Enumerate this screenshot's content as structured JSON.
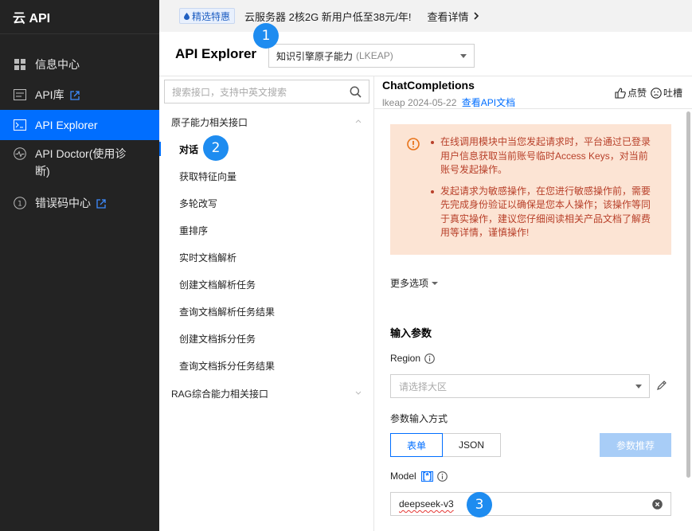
{
  "sidebar": {
    "brand": "云 API",
    "items": [
      {
        "label": "信息中心",
        "icon": "grid-icon",
        "external": false,
        "active": false
      },
      {
        "label": "API库",
        "icon": "library-icon",
        "external": true,
        "active": false
      },
      {
        "label": "API Explorer",
        "icon": "terminal-icon",
        "external": false,
        "active": true
      },
      {
        "label": "API Doctor(使用诊断)",
        "icon": "pulse-icon",
        "external": false,
        "active": false
      },
      {
        "label": "错误码中心",
        "icon": "error-code-icon",
        "external": true,
        "active": false
      }
    ]
  },
  "banner": {
    "badge": "精选特惠",
    "text": "云服务器 2核2G 新用户低至38元/年!",
    "link": "查看详情"
  },
  "header": {
    "title": "API Explorer",
    "product_select": "知识引擎原子能力",
    "product_select_sub": "(LKEAP)"
  },
  "api_list": {
    "search_placeholder": "搜索接口，支持中英文搜索",
    "groups": [
      {
        "label": "原子能力相关接口",
        "expanded": true,
        "items": [
          "对话",
          "获取特征向量",
          "多轮改写",
          "重排序",
          "实时文档解析",
          "创建文档解析任务",
          "查询文档解析任务结果",
          "创建文档拆分任务",
          "查询文档拆分任务结果"
        ],
        "selected": 0
      },
      {
        "label": "RAG综合能力相关接口",
        "expanded": false,
        "items": []
      }
    ]
  },
  "detail": {
    "api_name": "ChatCompletions",
    "meta_prefix": "lkeap 2024-05-22",
    "doc_link": "查看API文档",
    "like": "点赞",
    "complain": "吐槽",
    "warnings": [
      "在线调用模块中当您发起请求时，平台通过已登录用户信息获取当前账号临时Access Keys，对当前账号发起操作。",
      "发起请求为敏感操作，在您进行敏感操作前，需要先完成身份验证以确保是您本人操作；该操作等同于真实操作，建议您仔细阅读相关产品文档了解费用等详情，谨慎操作!"
    ],
    "more_options": "更多选项",
    "input_title": "输入参数",
    "region_label": "Region",
    "region_placeholder": "请选择大区",
    "input_mode_label": "参数输入方式",
    "mode_form": "表单",
    "mode_json": "JSON",
    "recommend_button": "参数推荐",
    "model_label": "Model",
    "model_required_mark": "[*]",
    "model_value": "deepseek-v3"
  },
  "annotations": [
    "1",
    "2",
    "3"
  ],
  "colors": {
    "accent": "#006eff",
    "sidebar_bg": "#232323",
    "warning_bg": "#fce4d4",
    "warning_text": "#b8402a",
    "step_marker": "#1e8cf0"
  }
}
